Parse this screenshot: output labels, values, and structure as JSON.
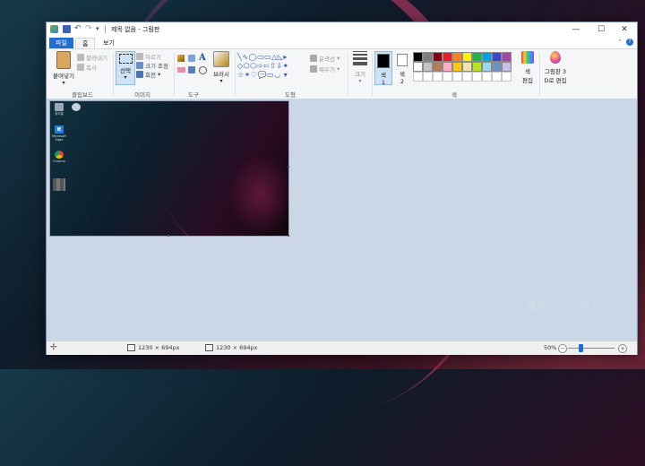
{
  "window": {
    "title": "제목 없음 - 그림판",
    "controls": [
      "—",
      "☐",
      "✕"
    ]
  },
  "tabs": {
    "file": "파일",
    "home": "홈",
    "view": "보기"
  },
  "ribbon": {
    "clipboard": {
      "paste": "붙여넣기",
      "cut": "잘라내기",
      "copy": "복사",
      "label": "클립보드"
    },
    "image": {
      "select": "선택",
      "crop": "자르기",
      "resize": "크기 조정",
      "rotate": "회전",
      "label": "이미지"
    },
    "tools": {
      "label": "도구",
      "text_icon": "A"
    },
    "brushes": {
      "label": "브러시"
    },
    "shapes": {
      "outline": "윤곽선",
      "fill": "채우기",
      "label": "도형"
    },
    "size": {
      "label": "크기"
    },
    "colors": {
      "color1": "색\n1",
      "color1_a": "색",
      "color1_b": "1",
      "color2_a": "색",
      "color2_b": "2",
      "edit_a": "색",
      "edit_b": "편집",
      "paint3d_a": "그림판 3",
      "paint3d_b": "D로 편집",
      "label": "색",
      "palette_row1": [
        "#000000",
        "#7f7f7f",
        "#880015",
        "#ed1c24",
        "#ff7f27",
        "#fff200",
        "#22b14c",
        "#00a2e8",
        "#3f48cc",
        "#a349a4"
      ],
      "palette_row2": [
        "#ffffff",
        "#c3c3c3",
        "#b97a57",
        "#ffaec9",
        "#ffc90e",
        "#efe4b0",
        "#b5e61d",
        "#99d9ea",
        "#7092be",
        "#c8bfe7"
      ]
    }
  },
  "desktop_icons": [
    "휴지통",
    "Microsoft Edge",
    "Chrome"
  ],
  "status": {
    "size1": "1230 × 694px",
    "size2": "1230 × 694px",
    "zoom": "50%"
  },
  "watermark": "블로그 스크린샷"
}
